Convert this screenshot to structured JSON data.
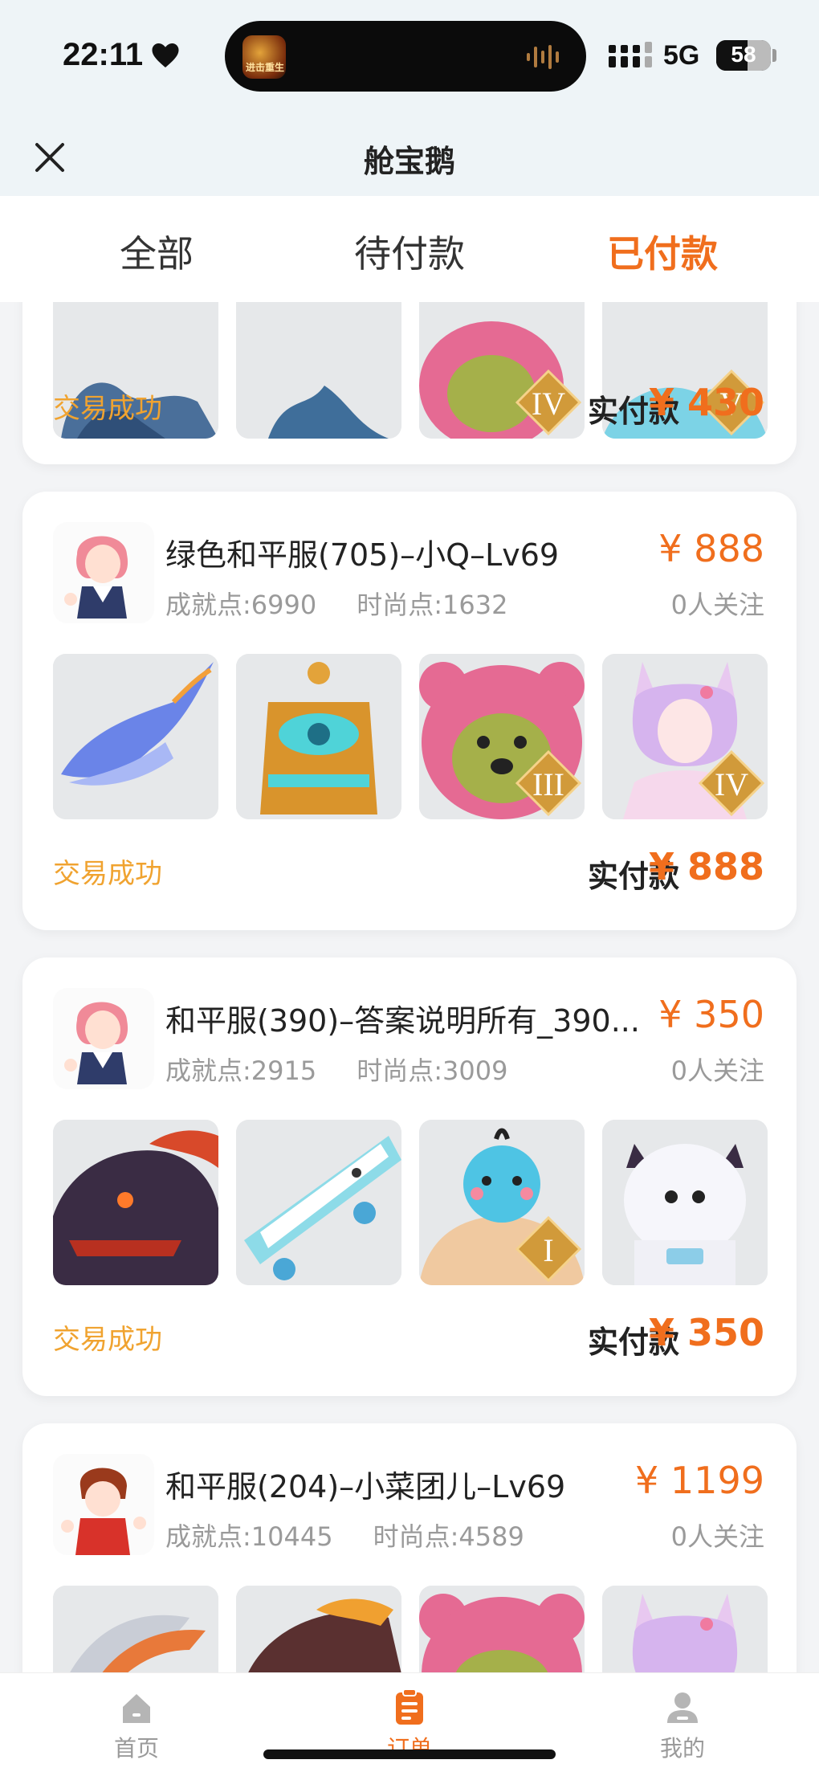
{
  "status_bar": {
    "time": "22:11",
    "network": "5G",
    "battery": "58",
    "battery_level": 0.58,
    "island_app_text": "进击重生"
  },
  "nav": {
    "title": "舱宝鹅"
  },
  "tabs": [
    {
      "label": "全部",
      "active": false
    },
    {
      "label": "待付款",
      "active": false
    },
    {
      "label": "已付款",
      "active": true
    }
  ],
  "orders": [
    {
      "title": "",
      "achievement": "",
      "fashion": "",
      "price": "",
      "followers": "",
      "status": "交易成功",
      "paid_label": "实付款",
      "paid_amount": "¥ 430",
      "thumbs": [
        "blue-dragon",
        "blue-dragon-tail",
        "pink-bear-iv",
        "fox-girl-v"
      ]
    },
    {
      "title": "绿色和平服(705)–小Q–Lv69",
      "achievement": "成就点:6990",
      "fashion": "时尚点:1632",
      "price": "¥ 888",
      "followers": "0人关注",
      "status": "交易成功",
      "paid_label": "实付款",
      "paid_amount": "¥ 888",
      "thumbs": [
        "ice-dragon",
        "golden-throne",
        "pink-bear-iii",
        "fox-girl-iv"
      ]
    },
    {
      "title": "和平服(390)–答案说明所有_390...",
      "achievement": "成就点:2915",
      "fashion": "时尚点:3009",
      "price": "¥ 350",
      "followers": "0人关注",
      "status": "交易成功",
      "paid_label": "实付款",
      "paid_amount": "¥ 350",
      "thumbs": [
        "dark-dragon",
        "bear-skateboard",
        "bird-muscle-i",
        "astronaut-cow"
      ]
    },
    {
      "title": "和平服(204)–小菜团儿–Lv69",
      "achievement": "成就点:10445",
      "fashion": "时尚点:4589",
      "price": "¥ 1199",
      "followers": "0人关注",
      "status": "",
      "paid_label": "",
      "paid_amount": "",
      "thumbs": [
        "white-dragon",
        "fire-dragon",
        "pink-bear",
        "fox-girl"
      ]
    }
  ],
  "rank_badges": [
    "IV",
    "V",
    "III",
    "IV",
    "I"
  ],
  "bottom_tabs": [
    {
      "label": "首页",
      "icon": "home-icon",
      "active": false
    },
    {
      "label": "订单",
      "icon": "order-icon",
      "active": true
    },
    {
      "label": "我的",
      "icon": "profile-icon",
      "active": false
    }
  ],
  "colors": {
    "accent": "#f06e1d",
    "success": "#f0a330",
    "muted": "#9a9a9a"
  }
}
